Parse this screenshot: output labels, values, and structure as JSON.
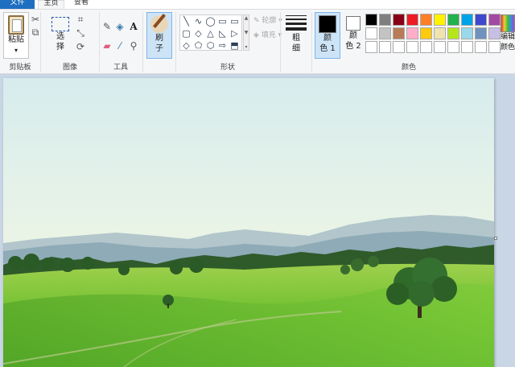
{
  "tabs": {
    "file": "文件",
    "home": "主页",
    "view": "查看"
  },
  "clipboard": {
    "paste_label": "粘贴",
    "group_label": "剪贴板"
  },
  "image": {
    "select_label": "选\n择",
    "group_label": "图像"
  },
  "tools": {
    "group_label": "工具"
  },
  "brushes": {
    "label": "刷\n子"
  },
  "shapes": {
    "group_label": "形状",
    "outline_label": "轮廓",
    "fill_label": "填充",
    "items": [
      "╲",
      "∿",
      "◯",
      "▭",
      "▭",
      "▢",
      "◇",
      "△",
      "◺",
      "▷",
      "◇",
      "⬠",
      "⬡",
      "⇨",
      "⬒"
    ]
  },
  "size": {
    "label": "粗\n细"
  },
  "colors": {
    "group_label": "颜色",
    "color1_label": "颜\n色 1",
    "color2_label": "颜\n色 2",
    "edit_label": "编辑\n颜色",
    "color1": "#000000",
    "color2": "#ffffff",
    "palette": [
      "#000000",
      "#7f7f7f",
      "#880015",
      "#ed1c24",
      "#ff7f27",
      "#fff200",
      "#22b14c",
      "#00a2e8",
      "#3f48cc",
      "#a349a4",
      "#ffffff",
      "#c3c3c3",
      "#b97a57",
      "#ffaec9",
      "#ffc90e",
      "#efe4b0",
      "#b5e61d",
      "#99d9ea",
      "#7092be",
      "#c8bfe7",
      "#ffffff",
      "#ffffff",
      "#ffffff",
      "#ffffff",
      "#ffffff",
      "#ffffff",
      "#ffffff",
      "#ffffff",
      "#ffffff",
      "#ffffff"
    ]
  },
  "icons": {
    "cut": "✂",
    "copy": "⧉",
    "crop": "⌗",
    "resize": "⤡",
    "rotate": "⟳",
    "pencil": "✎",
    "fill": "◈",
    "text": "A",
    "eraser": "▰",
    "picker": "⁄",
    "magnifier": "⚲",
    "dropdown": "▾"
  }
}
